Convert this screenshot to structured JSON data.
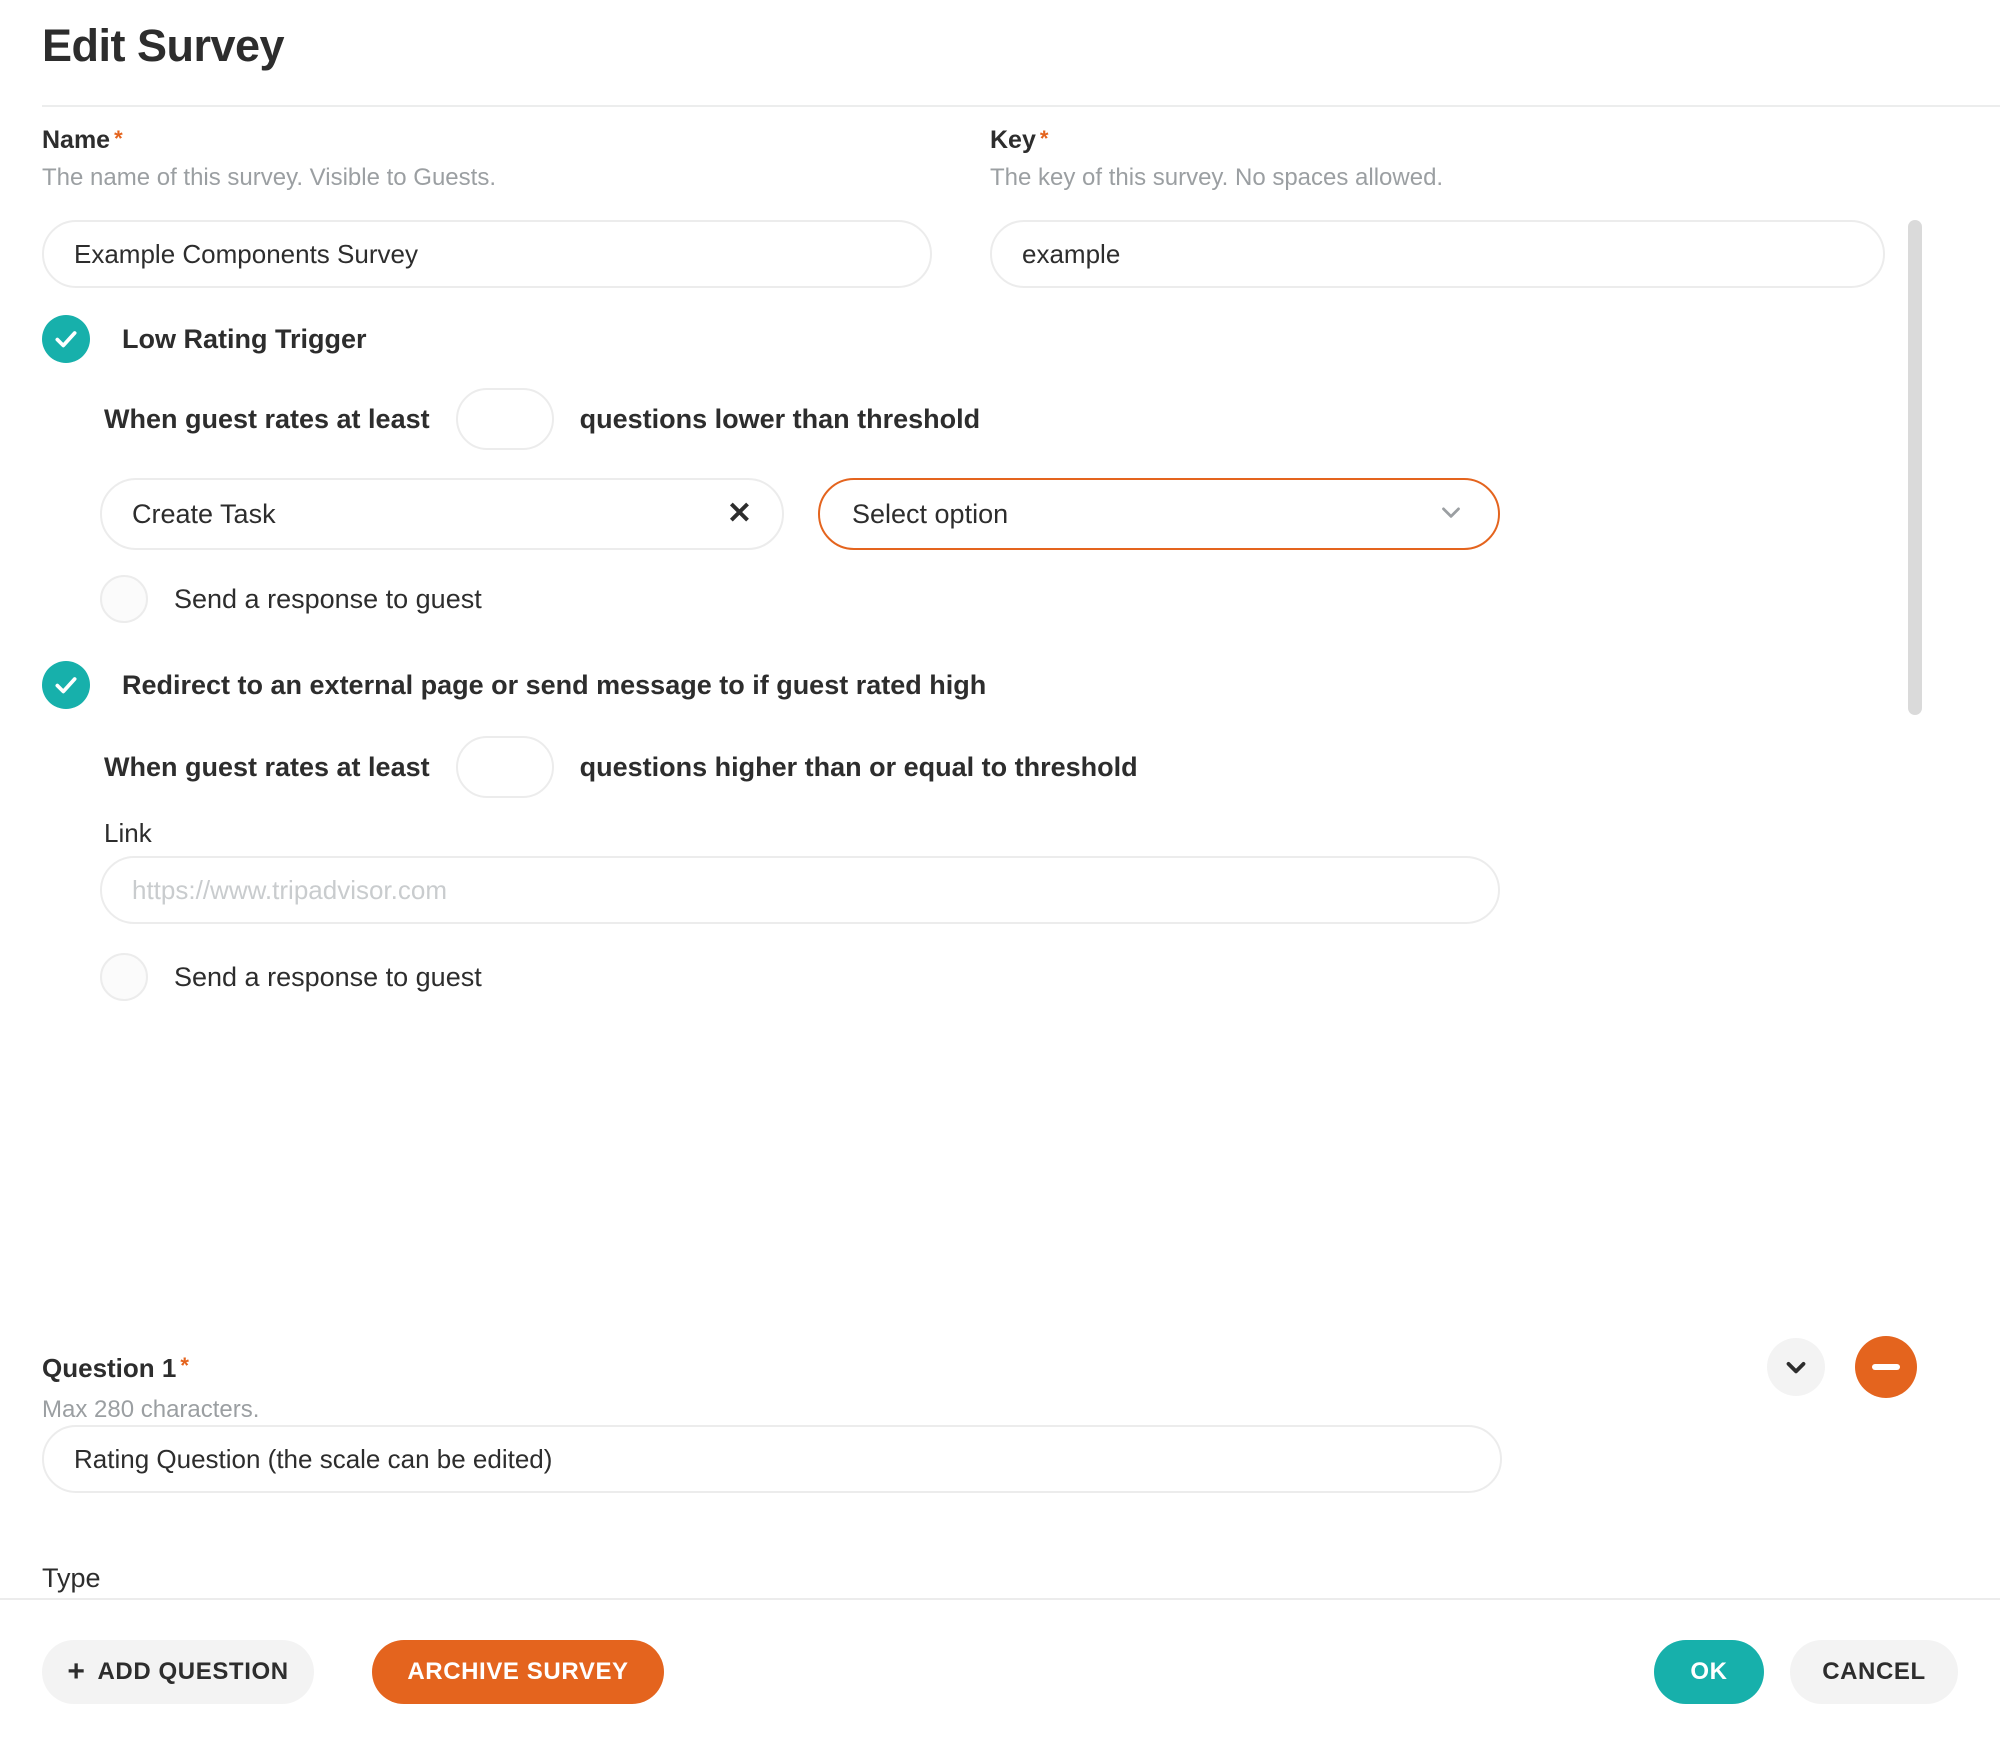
{
  "dialog": {
    "title": "Edit Survey"
  },
  "form": {
    "name": {
      "label": "Name",
      "required_mark": "*",
      "hint": "The name of this survey. Visible to Guests.",
      "value": "Example Components Survey",
      "placeholder": ""
    },
    "key": {
      "label": "Key",
      "required_mark": "*",
      "hint": "The key of this survey. No spaces allowed.",
      "value": "example",
      "placeholder": ""
    }
  },
  "low_rating_trigger": {
    "label": "Low Rating Trigger",
    "checked": true,
    "threshold": {
      "prefix": "When guest rates at least",
      "value": "",
      "suffix": "questions lower than threshold"
    },
    "action_chip": {
      "value": "Create Task",
      "clear_icon": "✕"
    },
    "option_select": {
      "value": "Select option",
      "chevron": "chevron-down"
    },
    "send_response": {
      "label": "Send a response to guest",
      "checked": false
    }
  },
  "high_rating_trigger": {
    "label": "Redirect to an external page or send message to if guest rated high",
    "checked": true,
    "threshold": {
      "prefix": "When guest rates at least",
      "value": "",
      "suffix": "questions higher than or equal to threshold"
    },
    "link": {
      "label": "Link",
      "value": "",
      "placeholder": "https://www.tripadvisor.com"
    },
    "send_response": {
      "label": "Send a response to guest",
      "checked": false
    }
  },
  "question": {
    "title": "Question 1",
    "required_mark": "*",
    "hint": "Max 280 characters.",
    "value": "Rating Question (the scale can be edited)",
    "placeholder": "",
    "type_label": "Type",
    "collapse_icon": "chevron-down",
    "remove_icon": "minus"
  },
  "footer": {
    "add_question": "ADD QUESTION",
    "add_question_icon": "+",
    "archive_survey": "ARCHIVE SURVEY",
    "ok": "OK",
    "cancel": "CANCEL"
  },
  "colors": {
    "teal": "#17b0ab",
    "orange": "#e4641e",
    "border": "#ececec",
    "hint_text": "#9b9fa2",
    "text": "#2d2d2d"
  }
}
